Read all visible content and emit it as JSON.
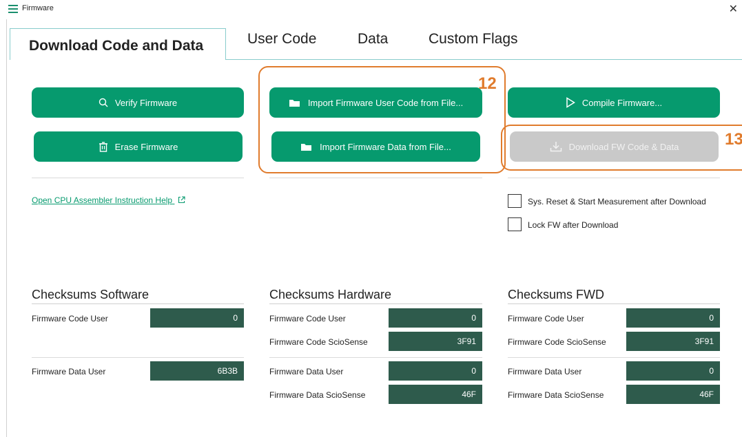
{
  "window": {
    "title": "Firmware",
    "close_icon": "close-icon"
  },
  "tabs": [
    {
      "label": "Download Code and Data",
      "active": true
    },
    {
      "label": "User Code",
      "active": false
    },
    {
      "label": "Data",
      "active": false
    },
    {
      "label": "Custom Flags",
      "active": false
    }
  ],
  "buttons": {
    "verify": {
      "label": "Verify Firmware",
      "icon": "search-icon"
    },
    "erase": {
      "label": "Erase Firmware",
      "icon": "trash-icon"
    },
    "import_code": {
      "label": "Import Firmware User Code from File...",
      "icon": "folder-icon"
    },
    "import_data": {
      "label": "Import Firmware Data from File...",
      "icon": "folder-icon"
    },
    "compile": {
      "label": "Compile Firmware...",
      "icon": "play-icon"
    },
    "download": {
      "label": "Download FW Code & Data",
      "icon": "download-icon",
      "disabled": true
    }
  },
  "annotations": {
    "a12": "12",
    "a13": "13"
  },
  "links": {
    "assembler_help": "Open CPU Assembler Instruction Help"
  },
  "options": {
    "reset_label": "Sys. Reset & Start Measurement after Download",
    "reset_checked": false,
    "lock_label": "Lock FW after Download",
    "lock_checked": false
  },
  "checksums": {
    "software": {
      "title": "Checksums Software",
      "code_user_label": "Firmware Code User",
      "code_user": "0",
      "data_user_label": "Firmware Data User",
      "data_user": "6B3B"
    },
    "hardware": {
      "title": "Checksums Hardware",
      "code_user_label": "Firmware Code User",
      "code_user": "0",
      "code_sciosense_label": "Firmware Code ScioSense",
      "code_sciosense": "3F91",
      "data_user_label": "Firmware Data User",
      "data_user": "0",
      "data_sciosense_label": "Firmware Data ScioSense",
      "data_sciosense": "46F"
    },
    "fwd": {
      "title": "Checksums FWD",
      "code_user_label": "Firmware Code User",
      "code_user": "0",
      "code_sciosense_label": "Firmware Code ScioSense",
      "code_sciosense": "3F91",
      "data_user_label": "Firmware Data User",
      "data_user": "0",
      "data_sciosense_label": "Firmware Data ScioSense",
      "data_sciosense": "46F"
    }
  },
  "colors": {
    "accent": "#069a6e",
    "value_bg": "#2e5b4c",
    "annotation": "#e07b2c",
    "disabled": "#c9c9c9"
  }
}
